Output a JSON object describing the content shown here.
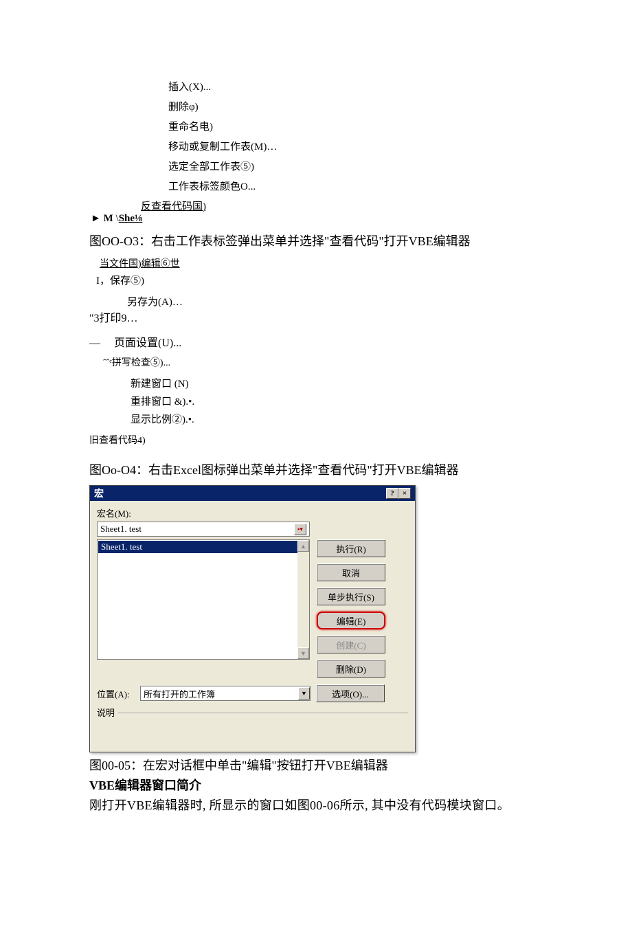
{
  "menu1": {
    "items": [
      "插入(X)...",
      "删除φ)",
      "重命名电)",
      "移动或复制工作表(M)…",
      "选定全部工作表⑤)",
      "工作表标签颜色O..."
    ],
    "view_code": "反查看代码国)",
    "m_she": {
      "triangle": "►",
      "m": "M",
      "slash": "\\",
      "she": "She⅛"
    }
  },
  "caption1": "图OO-O3：右击工作表标签弹出菜单并选择\"查看代码\"打开VBE编辑器",
  "menu2": {
    "file_edit": "当文件国)编辑⑥世",
    "save": "I，保存⑤)",
    "save_as": "另存为(A)…",
    "print": "\"3打印9…",
    "page_setup_dash": "—",
    "page_setup": "页面设置(U)...",
    "spell": "ˆˆᶜ拼写检查⑤)...",
    "items": [
      "新建窗口 (N)",
      "重排窗口 &).•.",
      "显示比例②).•."
    ],
    "old_view": "旧查看代码4)"
  },
  "caption2": "图Oo-O4：右击Excel图标弹出菜单并选择\"查看代码\"打开VBE编辑器",
  "dialog": {
    "title": "宏",
    "help": "?",
    "close": "×",
    "macro_name_label": "宏名(M):",
    "macro_name_value": "Sheet1. test",
    "list_item": "Sheet1. test",
    "buttons": {
      "run": "执行(R)",
      "cancel": "取消",
      "step": "单步执行(S)",
      "edit": "编辑(E)",
      "create": "创建(C)",
      "delete": "删除(D)",
      "options": "选项(O)..."
    },
    "location_label": "位置(A):",
    "location_value": "所有打开的工作簿",
    "desc_label": "说明"
  },
  "caption3": "图00-05：在宏对话框中单击\"编辑\"按钮打开VBE编辑器",
  "section_title": "VBE编辑器窗口简介",
  "body": "刚打开VBE编辑器时, 所显示的窗口如图00-06所示, 其中没有代码模块窗口。"
}
